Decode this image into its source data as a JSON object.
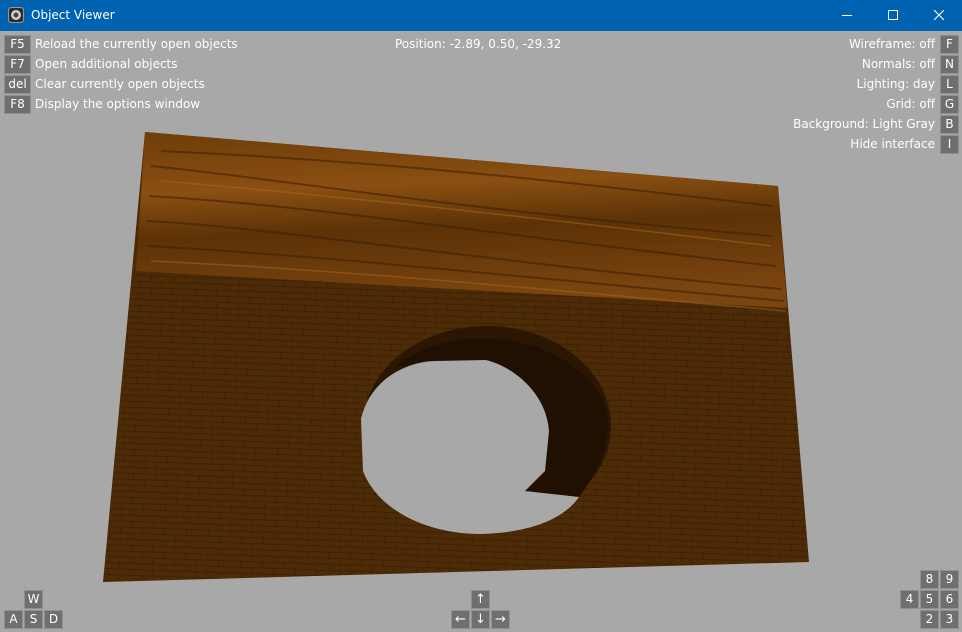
{
  "window": {
    "title": "Object Viewer",
    "icon": "object-viewer-app-icon",
    "controls": [
      "minimize-icon",
      "maximize-icon",
      "close-icon"
    ]
  },
  "shortcuts_left": [
    {
      "key": "F5",
      "label": "Reload the currently open objects"
    },
    {
      "key": "F7",
      "label": "Open additional objects"
    },
    {
      "key": "del",
      "label": "Clear currently open objects"
    },
    {
      "key": "F8",
      "label": "Display the options window"
    }
  ],
  "position": "Position: -2.89, 0.50, -29.32",
  "options_right": [
    {
      "label": "Wireframe: off",
      "key": "F"
    },
    {
      "label": "Normals: off",
      "key": "N"
    },
    {
      "label": "Lighting: day",
      "key": "L"
    },
    {
      "label": "Grid: off",
      "key": "G"
    },
    {
      "label": "Background: Light Gray",
      "key": "B"
    },
    {
      "label": "Hide interface",
      "key": "I"
    }
  ],
  "wasd_keys": {
    "w": "W",
    "a": "A",
    "s": "S",
    "d": "D"
  },
  "arrow_keys": {
    "up": "↑",
    "left": "←",
    "down": "↓",
    "right": "→"
  },
  "numpad_keys": {
    "k8": "8",
    "k9": "9",
    "k4": "4",
    "k5": "5",
    "k6": "6",
    "k2": "2",
    "k3": "3"
  },
  "colors": {
    "background": "#a8a8a8",
    "titlebar": "#0063b1",
    "wood": "#5a3306",
    "brick": "#4b2a06"
  }
}
